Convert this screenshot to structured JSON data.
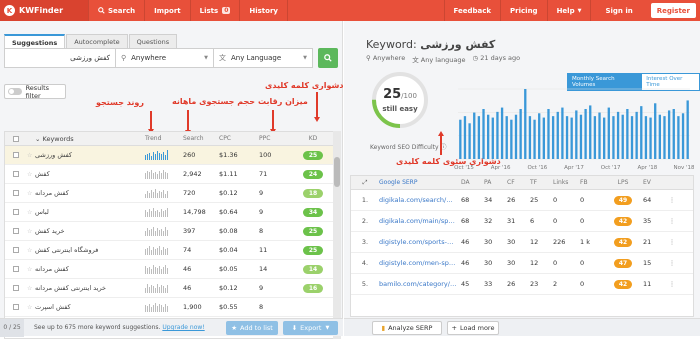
{
  "topbar": {
    "logo": "KWFinder",
    "nav": [
      {
        "label": "Search",
        "icon": "search-icon"
      },
      {
        "label": "Import"
      },
      {
        "label": "Lists",
        "badge": "0"
      },
      {
        "label": "History"
      }
    ],
    "right": [
      {
        "label": "Feedback"
      },
      {
        "label": "Pricing"
      },
      {
        "label": "Help"
      },
      {
        "label": "Sign in"
      }
    ],
    "register": "Register",
    "accent": "#e8503a"
  },
  "left": {
    "tabs": [
      "Suggestions",
      "Autocomplete",
      "Questions"
    ],
    "search": {
      "query": "کفش ورزشی",
      "location": "Anywhere",
      "language": "Any Language"
    },
    "results_filter": "Results filter",
    "table": {
      "headers": {
        "keyword": "Keywords",
        "trend": "Trend",
        "search": "Search",
        "cpc": "CPC",
        "ppc": "PPC",
        "kd": "KD"
      },
      "rows": [
        {
          "keyword": "کفش ورزشی",
          "trend": [
            0.5,
            0.6,
            0.7,
            0.4,
            0.8,
            0.6,
            0.9,
            0.7,
            0.6,
            0.8,
            0.5,
            1.0
          ],
          "search": "260",
          "cpc": "$1.36",
          "ppc": "100",
          "kd": "25",
          "selected": true
        },
        {
          "keyword": "کفش",
          "trend": [
            0.6,
            0.8,
            0.7,
            0.9,
            0.6,
            0.7,
            0.5,
            0.8,
            0.6,
            0.9,
            0.7,
            0.6
          ],
          "search": "2,942",
          "cpc": "$1.11",
          "ppc": "71",
          "kd": "24",
          "selected": false
        },
        {
          "keyword": "کفش مردانه",
          "trend": [
            0.4,
            0.7,
            0.5,
            0.8,
            0.6,
            0.9,
            0.5,
            0.7,
            0.6,
            0.8,
            0.4,
            0.7
          ],
          "search": "720",
          "cpc": "$0.12",
          "ppc": "9",
          "kd": "18",
          "selected": false
        },
        {
          "keyword": "لباس",
          "trend": [
            0.7,
            0.5,
            0.8,
            0.6,
            0.9,
            0.6,
            0.7,
            0.5,
            0.8,
            0.6,
            0.7,
            0.9
          ],
          "search": "14,798",
          "cpc": "$0.64",
          "ppc": "9",
          "kd": "34",
          "selected": false
        },
        {
          "keyword": "خرید کفش",
          "trend": [
            0.5,
            0.8,
            0.6,
            0.7,
            0.9,
            0.5,
            0.8,
            0.6,
            0.7,
            0.5,
            0.9,
            0.6
          ],
          "search": "397",
          "cpc": "$0.08",
          "ppc": "8",
          "kd": "25",
          "selected": false
        },
        {
          "keyword": "فروشگاه اینترنتی کفش",
          "trend": [
            0.6,
            0.7,
            0.9,
            0.5,
            0.8,
            0.6,
            0.7,
            0.9,
            0.5,
            0.8,
            0.6,
            0.7
          ],
          "search": "74",
          "cpc": "$0.04",
          "ppc": "11",
          "kd": "25",
          "selected": false
        },
        {
          "keyword": "کفش مردانه",
          "trend": [
            0.8,
            0.6,
            0.7,
            0.5,
            0.9,
            0.7,
            0.6,
            0.8,
            0.5,
            0.7,
            0.9,
            0.6
          ],
          "search": "46",
          "cpc": "$0.05",
          "ppc": "14",
          "kd": "14",
          "selected": false
        },
        {
          "keyword": "خرید اینترنتی کفش مردانه",
          "trend": [
            0.5,
            0.9,
            0.6,
            0.8,
            0.7,
            0.5,
            0.9,
            0.6,
            0.8,
            0.7,
            0.5,
            0.8
          ],
          "search": "46",
          "cpc": "$0.12",
          "ppc": "9",
          "kd": "16",
          "selected": false
        },
        {
          "keyword": "کفش اسپرت",
          "trend": [
            0.7,
            0.6,
            0.8,
            0.5,
            0.7,
            0.9,
            0.6,
            0.8,
            0.7,
            0.5,
            0.8,
            0.6
          ],
          "search": "1,900",
          "cpc": "$0.55",
          "ppc": "8",
          "kd": "",
          "selected": false
        }
      ]
    },
    "footer": {
      "count": "0 / 25",
      "suggest_text": "See up to 675 more keyword suggestions.",
      "upgrade": "Upgrade now!",
      "add_to_list": "Add to list",
      "export": "Export"
    }
  },
  "annotations": {
    "trend": "روند جستجو",
    "volume": "حجم جستجوی ماهانه",
    "competition": "میزان رقابت",
    "kd": "دشواری کلمه کلیدی",
    "seo_difficulty": "دشواری سئوی کلمه کلیدی"
  },
  "right": {
    "title_prefix": "Keyword:",
    "title_keyword": "کفش ورزشی",
    "location": "Anywhere",
    "language": "Any language",
    "age": "21 days ago",
    "kd": {
      "value": "25",
      "max": "/100",
      "text": "still easy",
      "label": "Keyword SEO Difficulty"
    },
    "chart_tabs": [
      "Monthly Search Volumes",
      "Interest Over Time"
    ],
    "chart_axis": [
      "Oct '15",
      "Apr '16",
      "Oct '16",
      "Apr '17",
      "Oct '17",
      "Apr '18",
      "Nov '18"
    ],
    "serp": {
      "headers": [
        "Google SERP",
        "DA",
        "PA",
        "CF",
        "TF",
        "Links",
        "FB",
        "LPS",
        "EV"
      ],
      "rows": [
        {
          "rank": "1.",
          "url": "digikala.com/search/…",
          "da": "68",
          "pa": "34",
          "cf": "26",
          "tf": "25",
          "links": "0",
          "fb": "0",
          "lps": "49",
          "ev": "64"
        },
        {
          "rank": "2.",
          "url": "digikala.com/main/sp…",
          "da": "68",
          "pa": "32",
          "cf": "31",
          "tf": "6",
          "links": "0",
          "fb": "0",
          "lps": "42",
          "ev": "35"
        },
        {
          "rank": "3.",
          "url": "digistyle.com/sports-…",
          "da": "46",
          "pa": "30",
          "cf": "30",
          "tf": "12",
          "links": "226",
          "fb": "1 k",
          "lps": "42",
          "ev": "21"
        },
        {
          "rank": "4.",
          "url": "digistyle.com/men-sp…",
          "da": "46",
          "pa": "30",
          "cf": "30",
          "tf": "12",
          "links": "0",
          "fb": "0",
          "lps": "47",
          "ev": "15"
        },
        {
          "rank": "5.",
          "url": "bamilo.com/category/…",
          "da": "45",
          "pa": "33",
          "cf": "26",
          "tf": "23",
          "links": "2",
          "fb": "0",
          "lps": "42",
          "ev": "11"
        }
      ]
    },
    "footer": {
      "analyze": "Analyze SERP",
      "load_more": "Load more"
    }
  },
  "chart_data": {
    "type": "bar",
    "title": "",
    "xlabel": "",
    "ylabel": "",
    "x_ticks": [
      "Oct '15",
      "Apr '16",
      "Oct '16",
      "Apr '17",
      "Oct '17",
      "Apr '18",
      "Nov '18"
    ],
    "series": [
      {
        "values": [
          0.55,
          0.6,
          0.5,
          0.65,
          0.6,
          0.7,
          0.62,
          0.58,
          0.66,
          0.72,
          0.6,
          0.55,
          0.62,
          0.7,
          0.98,
          0.6,
          0.55,
          0.64,
          0.58,
          0.7,
          0.6,
          0.66,
          0.72,
          0.6,
          0.58,
          0.68,
          0.62,
          0.7,
          0.75,
          0.6,
          0.65,
          0.58,
          0.72,
          0.6,
          0.66,
          0.62,
          0.7,
          0.6,
          0.66,
          0.74,
          0.6,
          0.58,
          0.78,
          0.62,
          0.6,
          0.68,
          0.7,
          0.6,
          0.64,
          0.82
        ]
      }
    ],
    "color": "#3a98d8"
  }
}
